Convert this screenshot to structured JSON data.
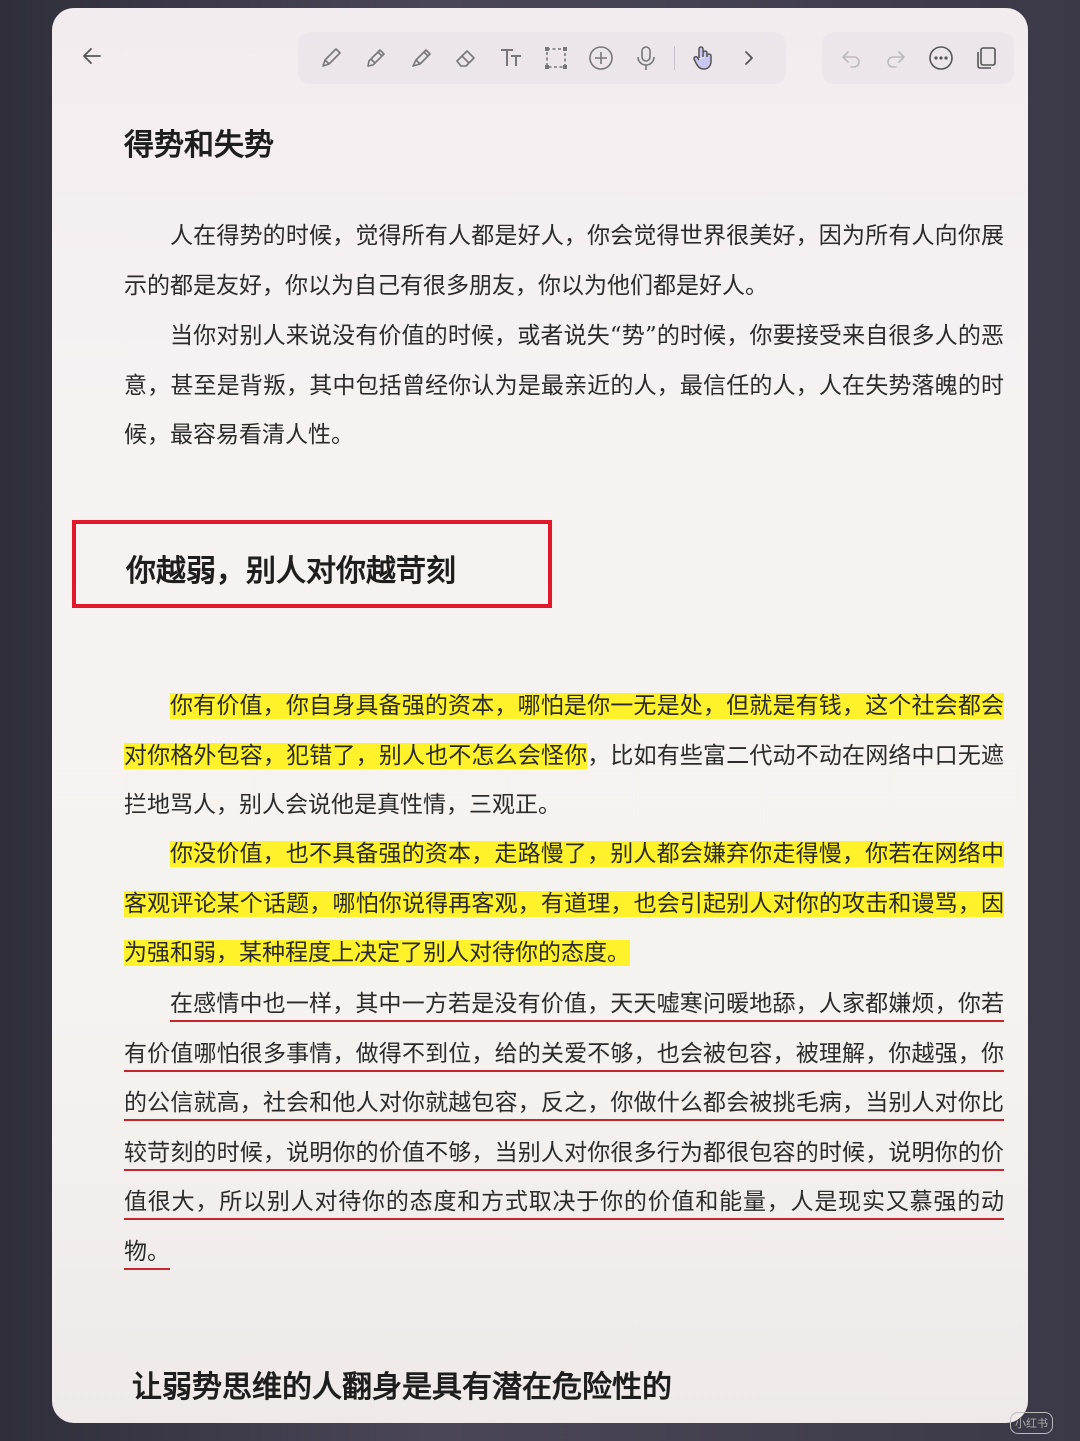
{
  "toolbar": {
    "left": [
      {
        "icon": "arrow-left-icon"
      }
    ],
    "tools": [
      {
        "icon": "pencil-icon"
      },
      {
        "icon": "pen-icon"
      },
      {
        "icon": "highlighter-icon"
      },
      {
        "icon": "eraser-icon"
      },
      {
        "icon": "text-tool-icon",
        "glyph": "Tt"
      },
      {
        "icon": "lasso-select-icon"
      },
      {
        "icon": "add-icon"
      },
      {
        "icon": "microphone-icon"
      },
      {
        "icon": "touch-hand-icon"
      },
      {
        "icon": "chevron-right-icon"
      }
    ],
    "right": [
      {
        "icon": "undo-icon"
      },
      {
        "icon": "redo-icon"
      },
      {
        "icon": "more-icon"
      },
      {
        "icon": "copy-pages-icon"
      }
    ],
    "accent_color": "#7b7bd6"
  },
  "content": {
    "heading1": "得势和失势",
    "para1": "人在得势的时候，觉得所有人都是好人，你会觉得世界很美好，因为所有人向你展示的都是友好，你以为自己有很多朋友，你以为他们都是好人。",
    "para2": "当你对别人来说没有价值的时候，或者说失“势”的时候，你要接受来自很多人的恶意，甚至是背叛，其中包括曾经你认为是最亲近的人，最信任的人，人在失势落魄的时候，最容易看清人性。",
    "heading2": "你越弱，别人对你越苛刻",
    "para3_highlight": "你有价值，你自身具备强的资本，哪怕是你一无是处，但就是有钱，这个社会都会对你格外包容，犯错了，别人也不怎么会怪你",
    "para3_rest": "，比如有些富二代动不动在网络中口无遮拦地骂人，别人会说他是真性情，三观正。",
    "para4_highlight": "你没价值，也不具备强的资本，走路慢了，别人都会嫌弃你走得慢，你若在网络中客观评论某个话题，哪怕你说得再客观，有道理，也会引起别人对你的攻击和谩骂，因为强和弱，某种程度上决定了别人对待你的态度。",
    "para5_underlined": "在感情中也一样，其中一方若是没有价值，天天嘘寒问暖地舔，人家都嫌烦，你若有价值哪怕很多事情，做得不到位，给的关爱不够，也会被包容，被理解，你越强，你的公信就高，社会和他人对你就越包容，反之，你做什么都会被挑毛病，当别人对你比较苛刻的时候，说明你的价值不够，当别人对你很多行为都很包容的时候，说明你的价值很大，所以别人对待你的态度和方式取决于你的价值和能量，人是现实又慕强的动物。",
    "heading3": "让弱势思维的人翻身是具有潜在危险性的",
    "highlight_color": "#fff22a",
    "box_color": "#e0182a",
    "underline_color": "#c2272d"
  },
  "watermark": "小红书"
}
